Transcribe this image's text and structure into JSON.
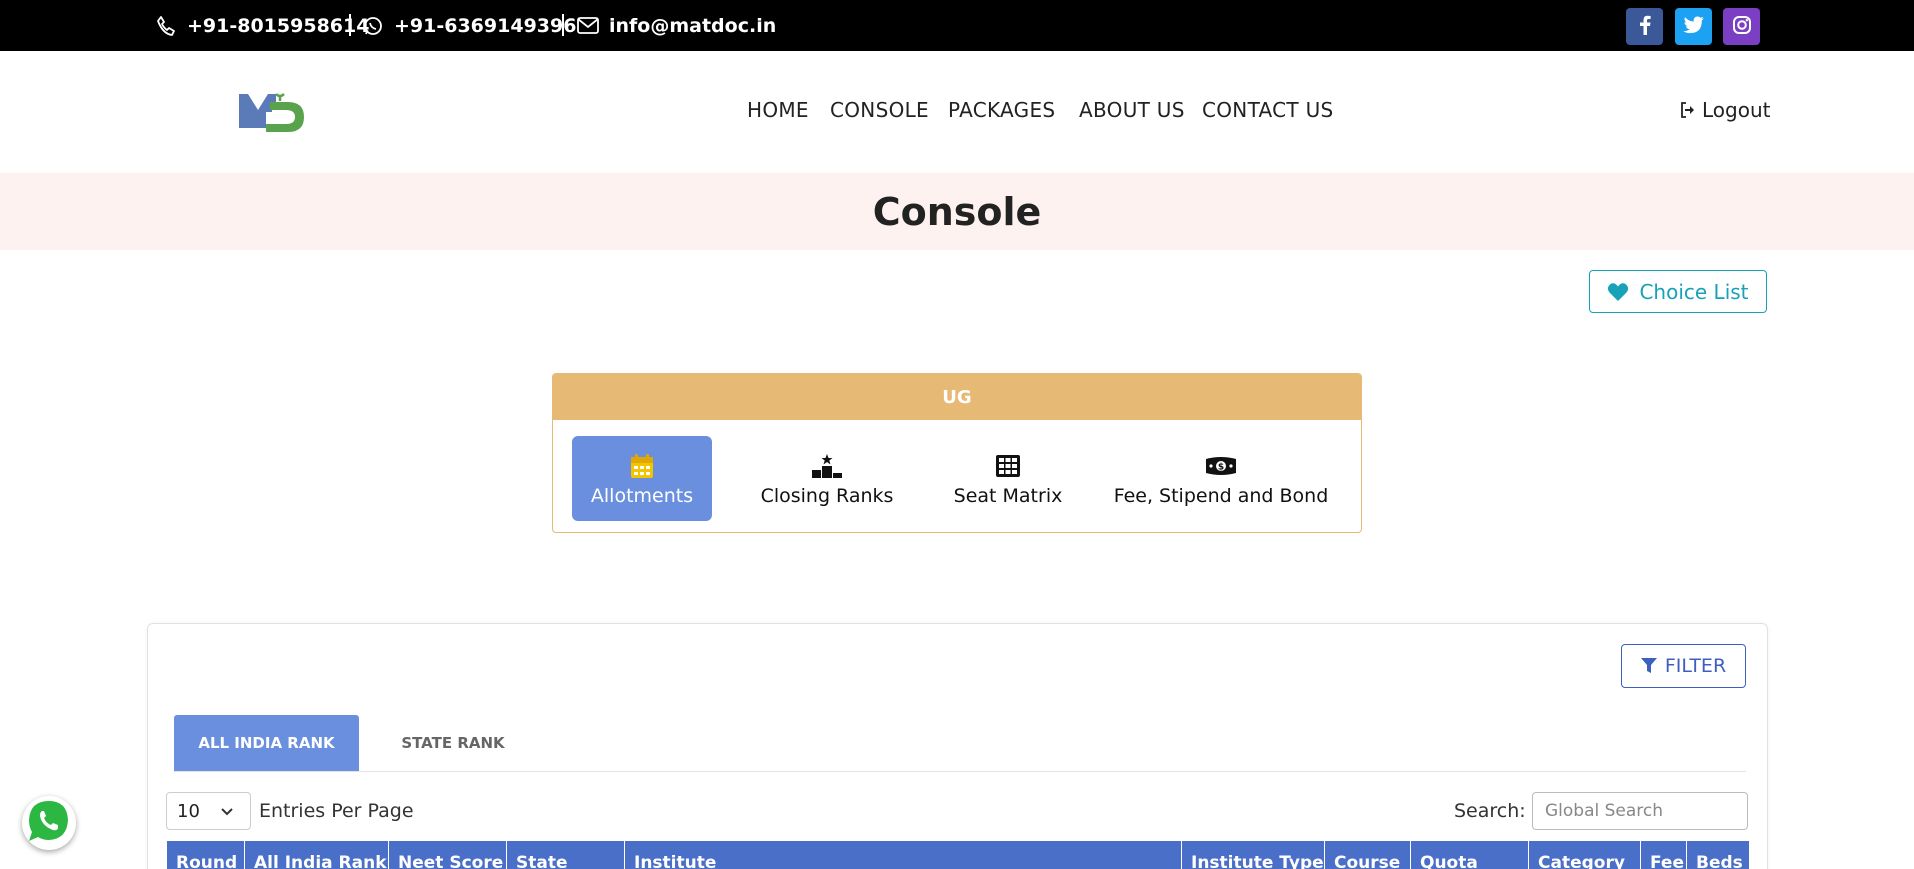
{
  "topbar": {
    "phone": "+91-8015958614",
    "whatsapp": "+91-6369149396",
    "email": "info@matdoc.in",
    "social": [
      {
        "name": "facebook",
        "glyph": "f",
        "color": "#3b5998"
      },
      {
        "name": "twitter",
        "glyph": "t",
        "color": "#1da1f2"
      },
      {
        "name": "instagram",
        "glyph": "ig",
        "color": "#7b3fc4"
      }
    ]
  },
  "nav": {
    "items": [
      "HOME",
      "CONSOLE",
      "PACKAGES",
      "ABOUT US",
      "CONTACT US"
    ],
    "logout": "Logout"
  },
  "banner": {
    "title": "Console"
  },
  "choice_list": {
    "label": "Choice List"
  },
  "ug_panel": {
    "header": "UG",
    "tabs": [
      {
        "label": "Allotments",
        "icon": "calendar-icon",
        "active": true
      },
      {
        "label": "Closing Ranks",
        "icon": "podium-icon",
        "active": false
      },
      {
        "label": "Seat Matrix",
        "icon": "grid-icon",
        "active": false
      },
      {
        "label": "Fee, Stipend and Bond",
        "icon": "money-icon",
        "active": false
      }
    ]
  },
  "data_card": {
    "filter_label": "FILTER",
    "rank_tabs": [
      {
        "label": "ALL INDIA RANK",
        "active": true
      },
      {
        "label": "STATE RANK",
        "active": false
      }
    ],
    "entries_value": "10",
    "entries_label": "Entries Per Page",
    "search_label": "Search:",
    "search_placeholder": "Global Search",
    "columns": [
      "Round",
      "All India Rank",
      "Neet Score",
      "State",
      "Institute",
      "Institute Type",
      "Course",
      "Quota",
      "Category",
      "Fee",
      "Beds"
    ]
  },
  "colors": {
    "accent_blue": "#6a8fde",
    "table_header": "#4a6fc9",
    "ug_gold": "#e6b974",
    "choice_teal": "#17a2b8"
  }
}
